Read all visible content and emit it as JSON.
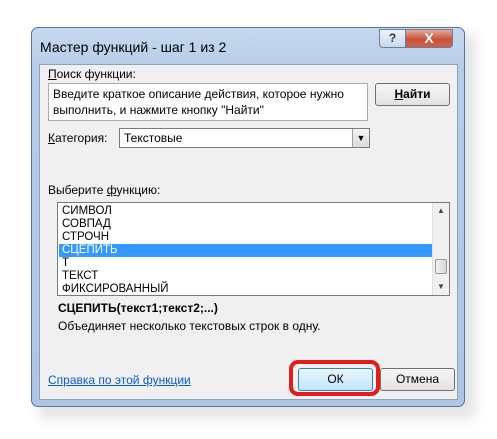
{
  "window": {
    "title": "Мастер функций - шаг 1 из 2",
    "help_glyph": "?",
    "close_glyph": "X"
  },
  "search": {
    "label_accel": "П",
    "label_rest": "оиск функции:",
    "value": "Введите краткое описание действия, которое нужно выполнить, и нажмите кнопку \"Найти\"",
    "find_accel": "Н",
    "find_rest": "айти"
  },
  "category": {
    "label_accel": "К",
    "label_rest": "атегория:",
    "value": "Текстовые",
    "arrow": "▼"
  },
  "functions": {
    "label_prefix": "Выберите ",
    "label_accel": "ф",
    "label_rest": "ункцию:",
    "items": [
      {
        "label": "СИМВОЛ",
        "selected": false
      },
      {
        "label": "СОВПАД",
        "selected": false
      },
      {
        "label": "СТРОЧН",
        "selected": false
      },
      {
        "label": "СЦЕПИТЬ",
        "selected": true
      },
      {
        "label": "Т",
        "selected": false
      },
      {
        "label": "ТЕКСТ",
        "selected": false
      },
      {
        "label": "ФИКСИРОВАННЫЙ",
        "selected": false
      }
    ],
    "scroll_up": "▲",
    "scroll_down": "▼"
  },
  "selected_function": {
    "syntax": "СЦЕПИТЬ(текст1;текст2;...)",
    "description": "Объединяет несколько текстовых строк в одну."
  },
  "footer": {
    "help_link": "Справка по этой функции",
    "ok": "ОК",
    "cancel": "Отмена"
  },
  "colors": {
    "selection": "#3399ff",
    "highlight_ring": "#e01c1c",
    "link": "#0b5bd4"
  }
}
